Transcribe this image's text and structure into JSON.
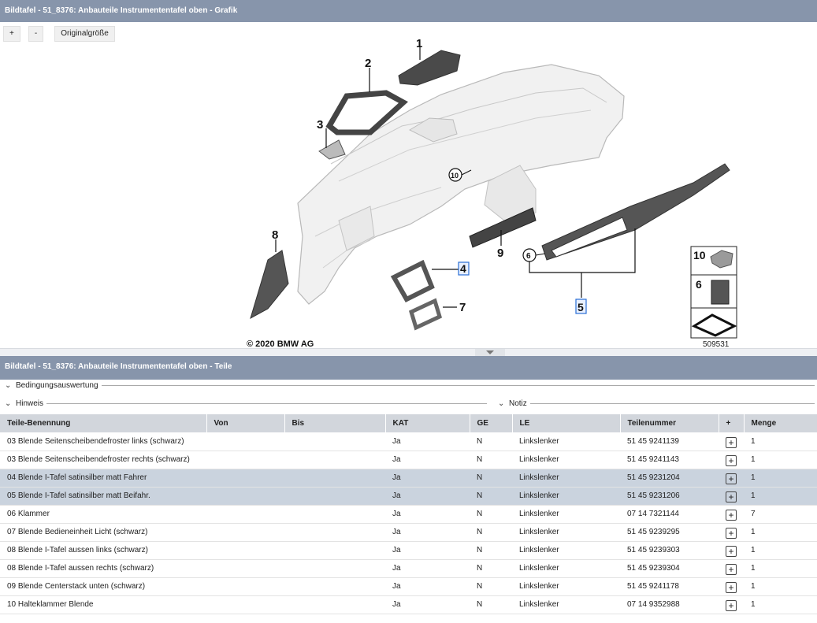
{
  "top_panel": {
    "title": "Bildtafel - 51_8376: Anbauteile Instrumententafel oben - Grafik",
    "toolbar": {
      "zoom_in": "+",
      "zoom_out": "-",
      "original_size": "Originalgröße"
    }
  },
  "diagram": {
    "callouts": [
      "1",
      "2",
      "3",
      "10",
      "8",
      "9",
      "6",
      "4",
      "7",
      "5"
    ],
    "legend": [
      "10",
      "6"
    ],
    "copyright": "© 2020 BMW AG",
    "image_number": "509531"
  },
  "parts_panel": {
    "title": "Bildtafel - 51_8376: Anbauteile Instrumententafel oben - Teile",
    "sections": {
      "conditions": "Bedingungsauswertung",
      "hint": "Hinweis",
      "note": "Notiz"
    },
    "columns": [
      "Teile-Benennung",
      "Von",
      "Bis",
      "KAT",
      "GE",
      "LE",
      "Teilenummer",
      "+",
      "Menge"
    ],
    "rows": [
      {
        "name": "03 Blende Seitenscheibendefroster links (schwarz)",
        "von": "",
        "bis": "",
        "kat": "Ja",
        "ge": "N",
        "le": "Linkslenker",
        "part_no": "51 45 9241139",
        "qty": "1",
        "selected": false
      },
      {
        "name": "03 Blende Seitenscheibendefroster rechts (schwarz)",
        "von": "",
        "bis": "",
        "kat": "Ja",
        "ge": "N",
        "le": "Linkslenker",
        "part_no": "51 45 9241143",
        "qty": "1",
        "selected": false
      },
      {
        "name": "04 Blende I-Tafel satinsilber matt Fahrer",
        "von": "",
        "bis": "",
        "kat": "Ja",
        "ge": "N",
        "le": "Linkslenker",
        "part_no": "51 45 9231204",
        "qty": "1",
        "selected": true
      },
      {
        "name": "05 Blende I-Tafel satinsilber matt Beifahr.",
        "von": "",
        "bis": "",
        "kat": "Ja",
        "ge": "N",
        "le": "Linkslenker",
        "part_no": "51 45 9231206",
        "qty": "1",
        "selected": true
      },
      {
        "name": "06 Klammer",
        "von": "",
        "bis": "",
        "kat": "Ja",
        "ge": "N",
        "le": "Linkslenker",
        "part_no": "07 14 7321144",
        "qty": "7",
        "selected": false
      },
      {
        "name": "07 Blende Bedieneinheit Licht (schwarz)",
        "von": "",
        "bis": "",
        "kat": "Ja",
        "ge": "N",
        "le": "Linkslenker",
        "part_no": "51 45 9239295",
        "qty": "1",
        "selected": false
      },
      {
        "name": "08 Blende I-Tafel aussen links (schwarz)",
        "von": "",
        "bis": "",
        "kat": "Ja",
        "ge": "N",
        "le": "Linkslenker",
        "part_no": "51 45 9239303",
        "qty": "1",
        "selected": false
      },
      {
        "name": "08 Blende I-Tafel aussen rechts (schwarz)",
        "von": "",
        "bis": "",
        "kat": "Ja",
        "ge": "N",
        "le": "Linkslenker",
        "part_no": "51 45 9239304",
        "qty": "1",
        "selected": false
      },
      {
        "name": "09 Blende Centerstack unten (schwarz)",
        "von": "",
        "bis": "",
        "kat": "Ja",
        "ge": "N",
        "le": "Linkslenker",
        "part_no": "51 45 9241178",
        "qty": "1",
        "selected": false
      },
      {
        "name": "10 Halteklammer Blende",
        "von": "",
        "bis": "",
        "kat": "Ja",
        "ge": "N",
        "le": "Linkslenker",
        "part_no": "07 14 9352988",
        "qty": "1",
        "selected": false
      }
    ],
    "add_icon": "+"
  },
  "colors": {
    "titlebar": "#8795ab",
    "header": "#d2d6dc",
    "selected_row": "#cad3de",
    "highlight_box": "#2a6fd6"
  }
}
